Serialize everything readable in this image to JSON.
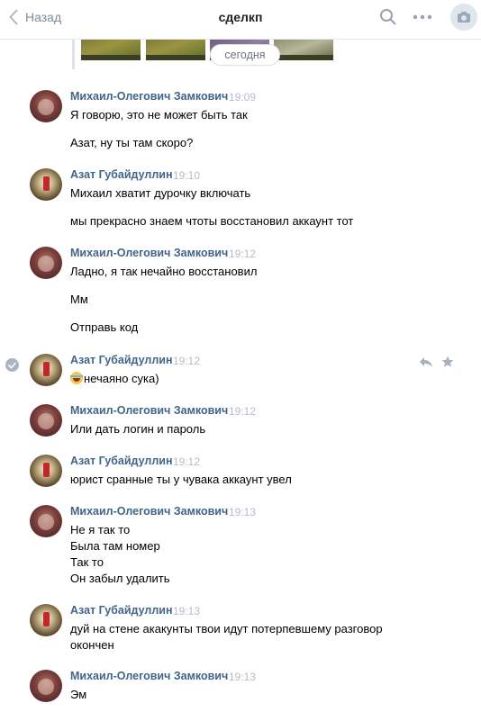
{
  "header": {
    "back_label": "Назад",
    "title": "сделкп",
    "icons": [
      "chevron-left-icon",
      "search-icon",
      "more-icon",
      "camera-icon"
    ]
  },
  "strip": {
    "date_label": "сегодня"
  },
  "messages": [
    {
      "author": "Михаил-Олегович Замкович",
      "time": "19:09",
      "avatar": "mikhail",
      "lines": [
        "Я говорю, это не может быть так",
        "Азат, ну ты там скоро?"
      ]
    },
    {
      "author": "Азат Губайдуллин",
      "time": "19:10",
      "avatar": "azat",
      "lines": [
        "Михаил хватит дурочку включать",
        "мы прекрасно знаем чтоты восстановил аккаунт тот"
      ]
    },
    {
      "author": "Михаил-Олегович Замкович",
      "time": "19:12",
      "avatar": "mikhail",
      "lines": [
        "Ладно, я так нечайно восстановил",
        "Мм",
        "Отправь код"
      ]
    },
    {
      "author": "Азат Губайдуллин",
      "time": "19:12",
      "avatar": "azat",
      "lines": [
        "нечаяно сука)"
      ]
    },
    {
      "author": "Михаил-Олегович Замкович",
      "time": "19:12",
      "avatar": "mikhail",
      "lines": [
        "Или дать логин и пароль"
      ]
    },
    {
      "author": "Азат Губайдуллин",
      "time": "19:12",
      "avatar": "azat",
      "lines": [
        "юрист сранные ты у чувака аккаунт увел"
      ]
    },
    {
      "author": "Михаил-Олегович Замкович",
      "time": "19:13",
      "avatar": "mikhail",
      "lines": [
        "Не я так то",
        "Была там номер",
        "Так то",
        "Он забыл удалить"
      ]
    },
    {
      "author": "Азат Губайдуллин",
      "time": "19:13",
      "avatar": "azat",
      "lines": [
        "дуй на стене акакунты твои идут потерпевшему разговор",
        "окончен"
      ]
    },
    {
      "author": "Михаил-Олегович Замкович",
      "time": "19:13",
      "avatar": "mikhail",
      "lines": [
        "Эм"
      ]
    }
  ],
  "colors": {
    "author": "#42648b",
    "time": "#b5bcc6",
    "accent": "#818c99"
  }
}
